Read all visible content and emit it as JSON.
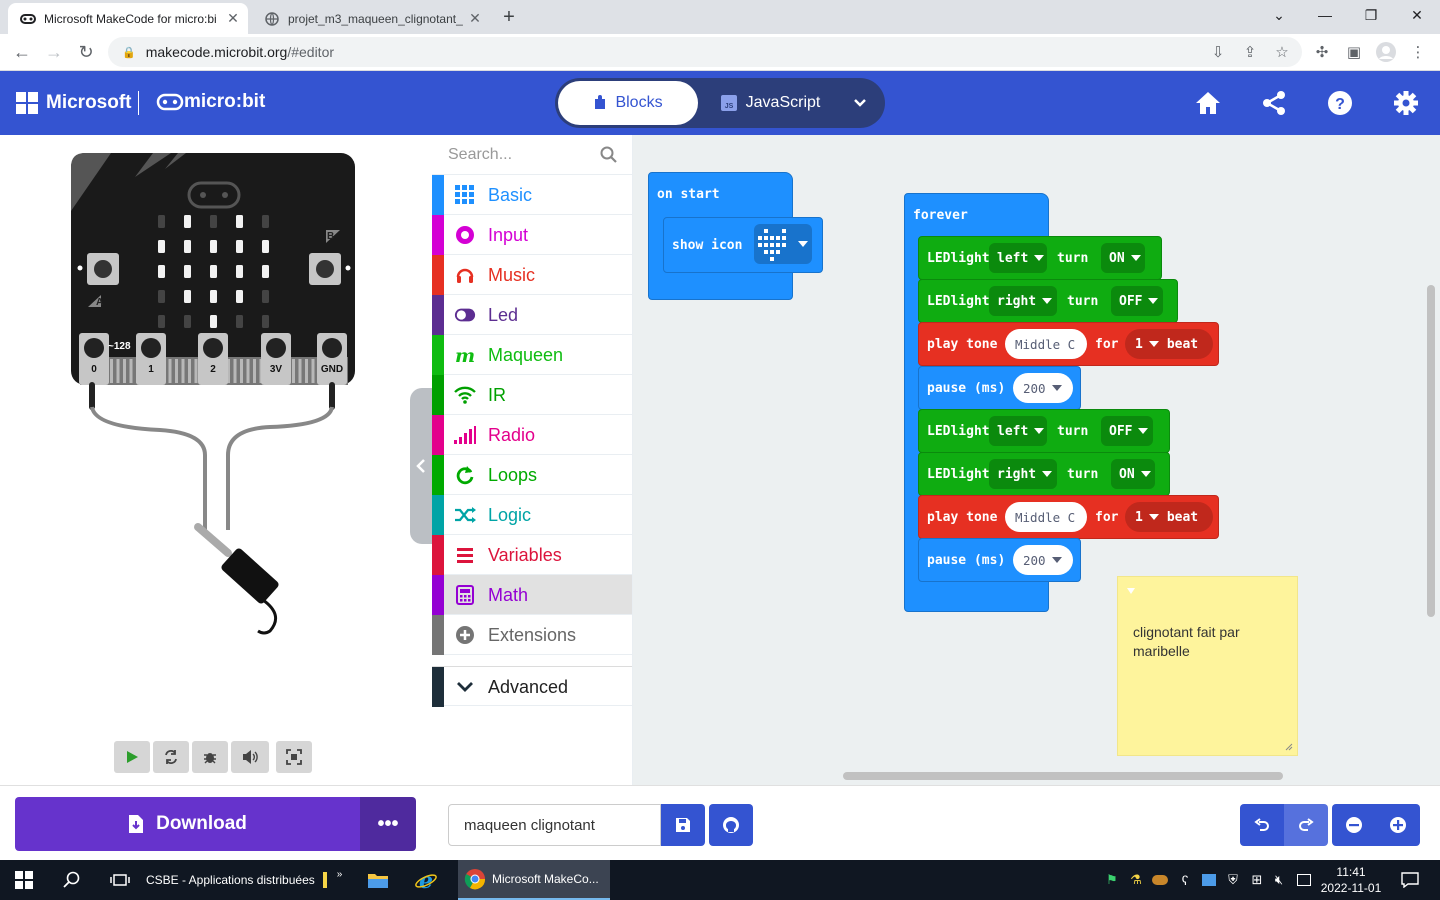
{
  "browser": {
    "tabs": [
      {
        "title": "Microsoft MakeCode for micro:bi",
        "active": true
      },
      {
        "title": "projet_m3_maqueen_clignotant_",
        "active": false
      }
    ],
    "new_tab": "+",
    "url_host": "makecode.microbit.org",
    "url_path": "/#editor",
    "window_controls": {
      "dropdown": "⌄",
      "minimize": "—",
      "maximize": "❐",
      "close": "✕"
    }
  },
  "header": {
    "microsoft_label": "Microsoft",
    "microbit_label": "micro:bit",
    "blocks_label": "Blocks",
    "javascript_label": "JavaScript",
    "colors": {
      "header_bg": "#3454d1",
      "toggle_bg": "#2c3e7a"
    }
  },
  "simulator": {
    "pins": [
      "0",
      "1",
      "2",
      "3V",
      "GND"
    ],
    "pin_extra": "~128",
    "button_a": "A",
    "button_b": "B",
    "controls": [
      "play-icon",
      "restart-icon",
      "debug-icon",
      "sound-icon",
      "fullscreen-icon"
    ]
  },
  "toolbox": {
    "search_placeholder": "Search...",
    "categories": [
      {
        "label": "Basic",
        "color": "#1e90ff",
        "icon": "grid-icon"
      },
      {
        "label": "Input",
        "color": "#d400d4",
        "icon": "input-icon"
      },
      {
        "label": "Music",
        "color": "#e63022",
        "icon": "headphones-icon"
      },
      {
        "label": "Led",
        "color": "#5c2d91",
        "icon": "toggle-icon"
      },
      {
        "label": "Maqueen",
        "color": "#0fbc11",
        "icon": "maqueen-icon"
      },
      {
        "label": "IR",
        "color": "#00a000",
        "icon": "wifi-icon"
      },
      {
        "label": "Radio",
        "color": "#e3008c",
        "icon": "signal-icon"
      },
      {
        "label": "Loops",
        "color": "#00aa00",
        "icon": "refresh-icon"
      },
      {
        "label": "Logic",
        "color": "#00a4a6",
        "icon": "shuffle-icon"
      },
      {
        "label": "Variables",
        "color": "#dc143c",
        "icon": "list-icon"
      },
      {
        "label": "Math",
        "color": "#9400d3",
        "icon": "calculator-icon"
      },
      {
        "label": "Extensions",
        "color": "#757575",
        "icon": "plus-circle-icon"
      },
      {
        "label": "Advanced",
        "color": "#1e2e3a",
        "icon": "chevron-down-icon"
      }
    ]
  },
  "workspace": {
    "on_start": {
      "label": "on start",
      "show_icon": "show icon"
    },
    "forever": {
      "label": "forever",
      "rows": [
        {
          "type": "led",
          "word": "LEDlight",
          "side": "left",
          "turn": "turn",
          "state": "ON"
        },
        {
          "type": "led",
          "word": "LEDlight",
          "side": "right",
          "turn": "turn",
          "state": "OFF"
        },
        {
          "type": "tone",
          "play": "play tone",
          "note": "Middle C",
          "for": "for",
          "beats": "1",
          "beat": "beat"
        },
        {
          "type": "pause",
          "label": "pause (ms)",
          "value": "200"
        },
        {
          "type": "led",
          "word": "LEDlight",
          "side": "left",
          "turn": "turn",
          "state": "OFF"
        },
        {
          "type": "led",
          "word": "LEDlight",
          "side": "right",
          "turn": "turn",
          "state": "ON"
        },
        {
          "type": "tone",
          "play": "play tone",
          "note": "Middle C",
          "for": "for",
          "beats": "1",
          "beat": "beat"
        },
        {
          "type": "pause",
          "label": "pause (ms)",
          "value": "200"
        }
      ]
    },
    "comment": "clignotant fait par maribelle",
    "colors": {
      "basic": "#1e90ff",
      "maqueen": "#0fac11",
      "music": "#e63022"
    }
  },
  "bottom": {
    "download_label": "Download",
    "more_label": "•••",
    "project_name": "maqueen clignotant"
  },
  "taskbar": {
    "pinned_label": "CSBE - Applications distribuées",
    "chevron": "»",
    "chrome_label": "Microsoft MakeCo...",
    "time": "11:41",
    "date": "2022-11-01"
  }
}
